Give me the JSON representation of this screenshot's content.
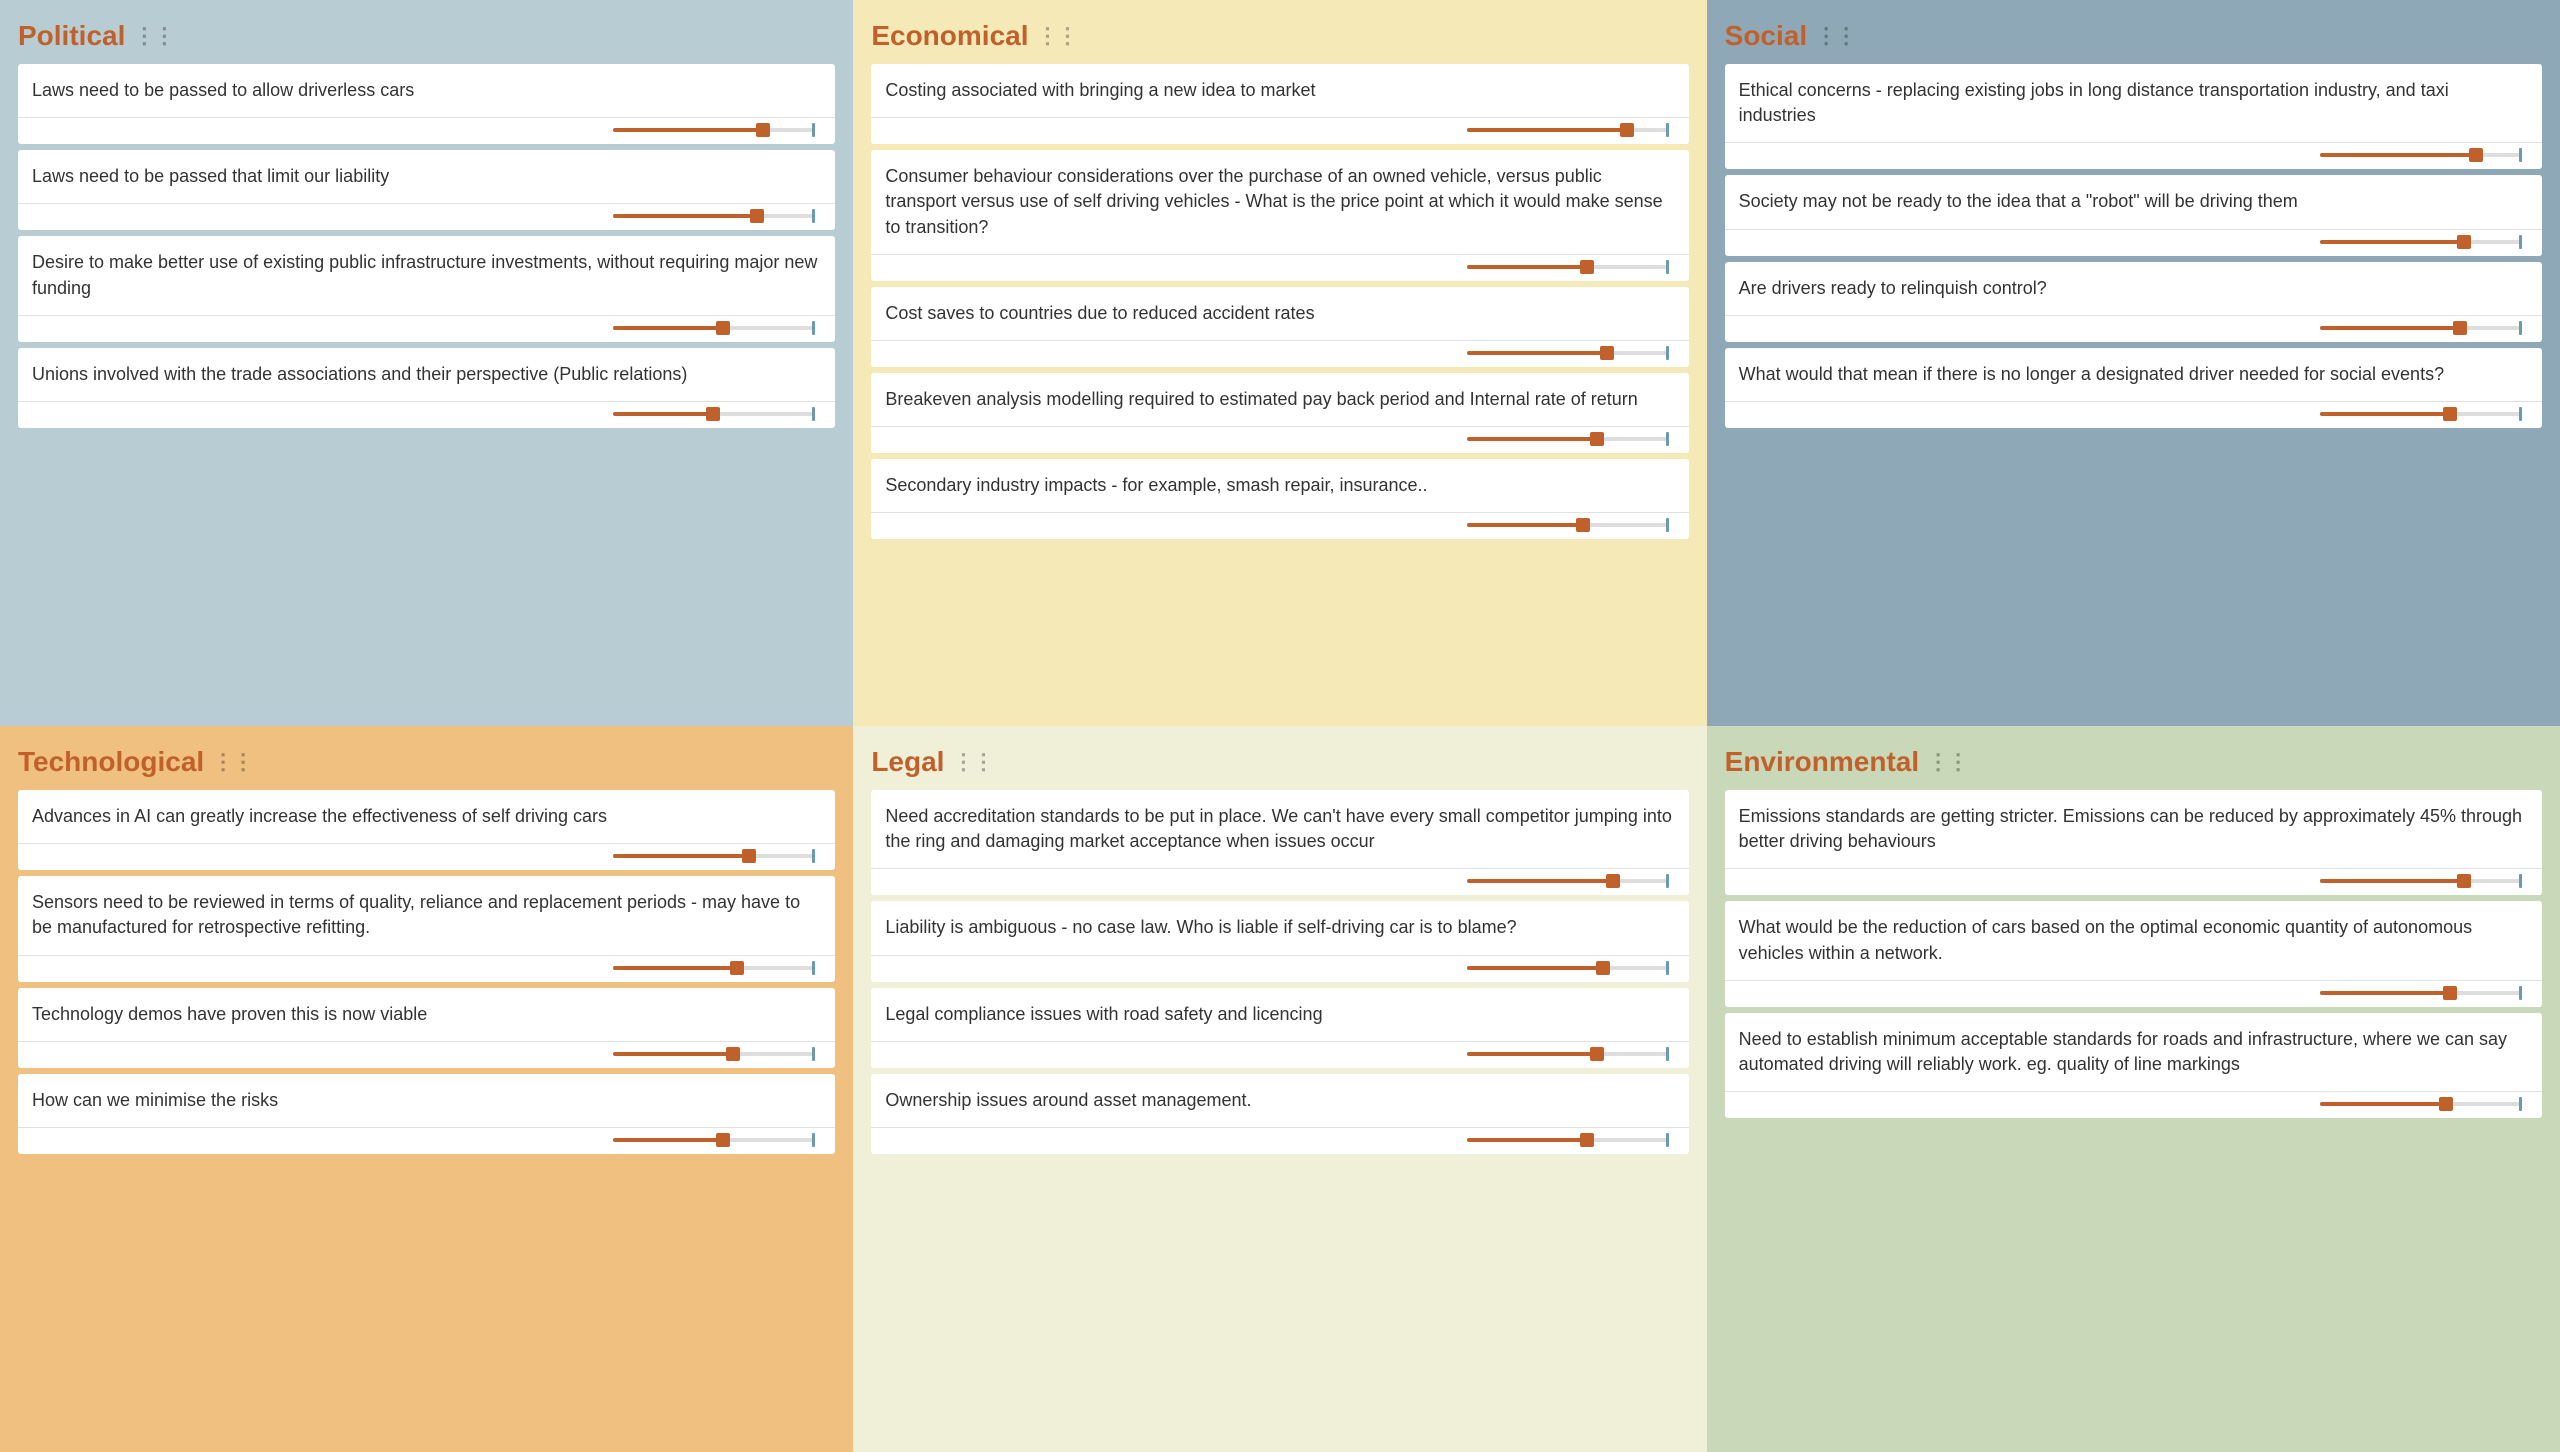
{
  "categories": [
    {
      "id": "political",
      "title": "Political",
      "class": "political",
      "cards": [
        {
          "text": "Laws need to be passed to allow driverless cars",
          "fill": 75
        },
        {
          "text": "Laws need to be passed that limit our liability",
          "fill": 72
        },
        {
          "text": "Desire to make better use of existing public infrastructure investments, without requiring major new funding",
          "fill": 55
        },
        {
          "text": "Unions involved with the trade associations and their perspective (Public relations)",
          "fill": 50
        }
      ]
    },
    {
      "id": "economical",
      "title": "Economical",
      "class": "economical",
      "cards": [
        {
          "text": "Costing associated with bringing a new idea to market",
          "fill": 80
        },
        {
          "text": "Consumer behaviour considerations over the purchase of an owned vehicle, versus public transport versus use of self driving vehicles - What is the price point at which it would make sense to transition?",
          "fill": 60
        },
        {
          "text": "Cost saves to countries due to reduced accident rates",
          "fill": 70
        },
        {
          "text": "Breakeven analysis modelling required to estimated pay back period and Internal rate of return",
          "fill": 65
        },
        {
          "text": "Secondary industry impacts - for example, smash repair, insurance..",
          "fill": 58
        }
      ]
    },
    {
      "id": "social",
      "title": "Social",
      "class": "social",
      "cards": [
        {
          "text": "Ethical concerns - replacing existing jobs in long distance transportation industry, and taxi industries",
          "fill": 78
        },
        {
          "text": "Society may not be ready to the idea that a \"robot\" will be driving them",
          "fill": 72
        },
        {
          "text": "Are drivers ready to relinquish control?",
          "fill": 70
        },
        {
          "text": "What would that mean if there is no longer a designated driver needed for social events?",
          "fill": 65
        }
      ]
    },
    {
      "id": "technological",
      "title": "Technological",
      "class": "technological",
      "cards": [
        {
          "text": "Advances in AI can greatly increase the effectiveness of self driving cars",
          "fill": 68
        },
        {
          "text": "Sensors need to be reviewed in terms of quality, reliance and replacement periods - may have to be manufactured for retrospective refitting.",
          "fill": 62
        },
        {
          "text": "Technology demos have proven this is now viable",
          "fill": 60
        },
        {
          "text": "How can we minimise the risks",
          "fill": 55
        }
      ]
    },
    {
      "id": "legal",
      "title": "Legal",
      "class": "legal",
      "cards": [
        {
          "text": "Need accreditation standards to be put in place. We can't have every small competitor jumping into the ring and damaging market acceptance when issues occur",
          "fill": 73
        },
        {
          "text": "Liability is ambiguous - no case law. Who is liable if self-driving car is to blame?",
          "fill": 68
        },
        {
          "text": "Legal compliance issues with road safety and licencing",
          "fill": 65
        },
        {
          "text": "Ownership issues around asset management.",
          "fill": 60
        }
      ]
    },
    {
      "id": "environmental",
      "title": "Environmental",
      "class": "environmental",
      "cards": [
        {
          "text": "Emissions standards are getting stricter. Emissions can be reduced by approximately 45% through better driving behaviours",
          "fill": 72
        },
        {
          "text": "What would be the reduction of cars based on the optimal economic quantity of autonomous vehicles within a network.",
          "fill": 65
        },
        {
          "text": "Need to establish minimum acceptable standards for roads and infrastructure, where we can say automated driving will reliably work. eg. quality of line markings",
          "fill": 63
        }
      ]
    }
  ],
  "drag_dots": "⋮⋮"
}
